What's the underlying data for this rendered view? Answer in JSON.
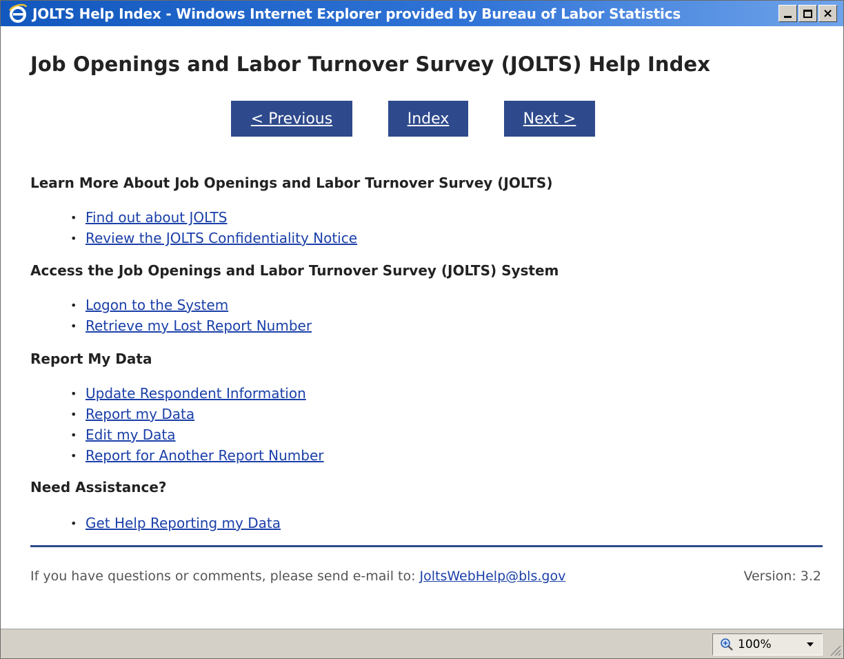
{
  "window": {
    "title": "JOLTS Help Index - Windows Internet Explorer provided by Bureau of Labor Statistics",
    "controls": {
      "minimize": "_",
      "maximize": "□",
      "close": "×"
    }
  },
  "page": {
    "title": "Job Openings and Labor Turnover Survey (JOLTS) Help Index"
  },
  "nav": {
    "previous": "< Previous",
    "index": "Index",
    "next": "Next >"
  },
  "sections": [
    {
      "heading": "Learn More About Job Openings and Labor Turnover Survey (JOLTS)",
      "links": [
        "Find out about JOLTS",
        "Review the JOLTS Confidentiality Notice"
      ]
    },
    {
      "heading": "Access the Job Openings and Labor Turnover Survey (JOLTS) System",
      "links": [
        "Logon to the System",
        "Retrieve my Lost Report Number"
      ]
    },
    {
      "heading": "Report My Data",
      "links": [
        "Update Respondent Information",
        "Report my Data",
        "Edit my Data",
        "Report for Another Report Number"
      ]
    },
    {
      "heading": "Need Assistance?",
      "links": [
        "Get Help Reporting my Data"
      ]
    }
  ],
  "footer": {
    "text": "If you have questions or comments, please send e-mail to: ",
    "email": "JoltsWebHelp@bls.gov",
    "version": "Version: 3.2"
  },
  "statusbar": {
    "zoom": "100%"
  },
  "colors": {
    "nav_button_bg": "#2e4a8c",
    "link": "#1a3fa8",
    "titlebar": "#1257bd",
    "divider": "#2e4a8c"
  },
  "icons": [
    "ie-logo-icon",
    "zoom-icon",
    "chevron-down-icon",
    "resize-grip-icon"
  ]
}
